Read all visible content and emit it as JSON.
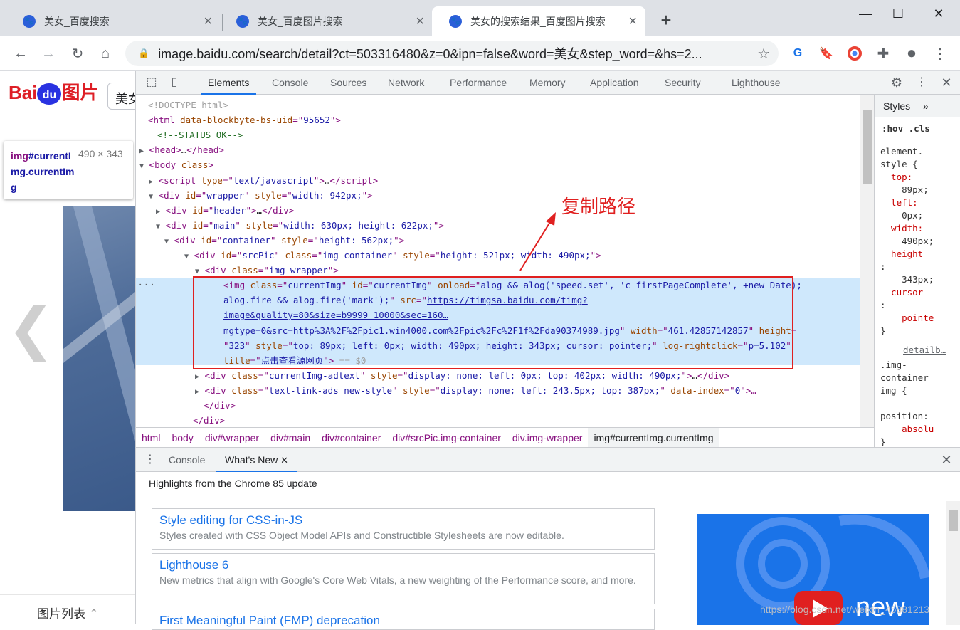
{
  "tabs": [
    {
      "title": "美女_百度搜索",
      "active": false
    },
    {
      "title": "美女_百度图片搜索",
      "active": false
    },
    {
      "title": "美女的搜索结果_百度图片搜索",
      "active": true
    }
  ],
  "new_tab": "+",
  "window": {
    "minimize": "—",
    "maximize": "☐",
    "close": "✕"
  },
  "toolbar": {
    "back": "←",
    "forward": "→",
    "reload": "↻",
    "home": "⌂",
    "url": "image.baidu.com/search/detail?ct=503316480&z=0&ipn=false&word=美女&step_word=&hs=2...",
    "star": "☆",
    "translate": "G",
    "bookmark": "🔖",
    "ext": "✚",
    "profile": "●",
    "menu": "⋮"
  },
  "page": {
    "logo_text": "Bai",
    "logo_du": "du",
    "logo_suffix": "图片",
    "search_value": "美女",
    "tooltip_tag": "img",
    "tooltip_id": "#currentImg.currentImg",
    "tooltip_dim": "490 × 343",
    "list_label": "图片列表",
    "prev_arrow": "❮"
  },
  "devtools": {
    "tabs": [
      "Elements",
      "Console",
      "Sources",
      "Network",
      "Performance",
      "Memory",
      "Application",
      "Security",
      "Lighthouse"
    ],
    "annotation": "复制路径",
    "lines": [
      {
        "indent": 0,
        "html": "<span class='gr'>&lt;!DOCTYPE html&gt;</span>"
      },
      {
        "indent": 0,
        "html": "&lt;html <span class='an'>data-blockbyte-bs-uid</span>=\"<span class='av'>95652</span>\"&gt;"
      },
      {
        "indent": 1,
        "html": "<span class='cm'>&lt;!--STATUS OK--&gt;</span>"
      },
      {
        "indent": 0,
        "arrow": "▶",
        "html": "&lt;head&gt;<span class='tx'>…</span>&lt;/head&gt;"
      },
      {
        "indent": 0,
        "arrow": "▼",
        "html": "&lt;body <span class='an'>class</span>&gt;"
      },
      {
        "indent": 1,
        "arrow": "▶",
        "html": "&lt;script <span class='an'>type</span>=\"<span class='av'>text/javascript</span>\"&gt;<span class='tx'>…</span>&lt;/script&gt;"
      },
      {
        "indent": 1,
        "arrow": "▼",
        "html": "&lt;div <span class='an'>id</span>=\"<span class='av'>wrapper</span>\" <span class='an'>style</span>=\"<span class='av'>width: 942px;</span>\"&gt;"
      },
      {
        "indent": 2,
        "arrow": "▶",
        "html": "&lt;div <span class='an'>id</span>=\"<span class='av'>header</span>\"&gt;<span class='tx'>…</span>&lt;/div&gt;"
      },
      {
        "indent": 2,
        "arrow": "▼",
        "html": "&lt;div <span class='an'>id</span>=\"<span class='av'>main</span>\" <span class='an'>style</span>=\"<span class='av'>width: 630px; height: 622px;</span>\"&gt;"
      },
      {
        "indent": 3,
        "arrow": "▼",
        "html": "&lt;div <span class='an'>id</span>=\"<span class='av'>container</span>\" <span class='an'>style</span>=\"<span class='av'>height: 562px;</span>\"&gt;"
      },
      {
        "indent": 4,
        "arrow": "▼",
        "html": "&lt;div <span class='an'>id</span>=\"<span class='av'>srcPic</span>\" <span class='an'>class</span>=\"<span class='av'>img-container</span>\" <span class='an'>style</span>=\"<span class='av'>height: 521px; width: 490px;</span>\"&gt;"
      },
      {
        "indent": 5,
        "arrow": "▼",
        "html": "&lt;div <span class='an'>class</span>=\"<span class='av'>img-wrapper</span>\"&gt;"
      },
      {
        "indent": 6,
        "html": "&lt;img <span class='an'>class</span>=\"<span class='av'>currentImg</span>\" <span class='an'>id</span>=\"<span class='av'>currentImg</span>\" <span class='an'>onload</span>=\"<span class='av'>alog &amp;&amp; alog('speed.set', 'c_firstPageComplete', +new Date);</span>"
      },
      {
        "indent": 6,
        "html": "<span class='av'>alog.fire &amp;&amp; alog.fire('mark');</span>\" <span class='an'>src</span>=\"<span class='lk'>https://timgsa.baidu.com/timg?</span>"
      },
      {
        "indent": 6,
        "html": "<span class='lk'>image&amp;quality=80&amp;size=b9999_10000&amp;sec=160…</span>"
      },
      {
        "indent": 6,
        "html": "<span class='lk'>mgtype=0&amp;src=http%3A%2F%2Fpic1.win4000.com%2Fpic%2Fc%2F1f%2Fda90374989.jpg</span>\" <span class='an'>width</span>=\"<span class='av'>461.42857142857</span>\" <span class='an'>height</span>="
      },
      {
        "indent": 6,
        "html": "\"<span class='av'>323</span>\" <span class='an'>style</span>=\"<span class='av'>top: 89px; left: 0px; width: 490px; height: 343px; cursor: pointer;</span>\" <span class='an'>log-rightclick</span>=\"<span class='av'>p=5.102</span>\""
      },
      {
        "indent": 6,
        "html": "<span class='an'>title</span>=\"<span class='av'>点击查看源网页</span>\"&gt; <span class='gr'>== $0</span>"
      },
      {
        "indent": 5,
        "arrow": "▶",
        "html": "&lt;div <span class='an'>class</span>=\"<span class='av'>currentImg-adtext</span>\" <span class='an'>style</span>=\"<span class='av'>display: none; left: 0px; top: 402px; width: 490px;</span>\"&gt;<span class='tx'>…</span>&lt;/div&gt;"
      },
      {
        "indent": 5,
        "arrow": "▶",
        "html": "&lt;div <span class='an'>class</span>=\"<span class='av'>text-link-ads new-style</span>\" <span class='an'>style</span>=\"<span class='av'>display: none; left: 243.5px; top: 387px;</span>\" <span class='an'>data-index</span>=\"<span class='av'>0</span>\"&gt;…"
      },
      {
        "indent": 5,
        "html": "&lt;/div&gt;"
      },
      {
        "indent": 4,
        "html": "&lt;/div&gt;"
      }
    ],
    "breadcrumbs": [
      "html",
      "body",
      "div#wrapper",
      "div#main",
      "div#container",
      "div#srcPic.img-container",
      "div.img-wrapper",
      "img#currentImg.currentImg"
    ],
    "styles": {
      "tab": "Styles",
      "more": "»",
      "filter": ":hov  .cls",
      "rules": [
        "element.",
        "style {",
        "  top:",
        "    89px;",
        "  left:",
        "    0px;",
        "  width:",
        "    490px;",
        "  height",
        ":",
        "    343px;",
        "  cursor",
        ":",
        "    pointe",
        "}"
      ],
      "source": "detailb…",
      "rule2": [
        ".img-",
        "container",
        "img {",
        "",
        "position:",
        "    absolu",
        "}"
      ]
    },
    "drawer": {
      "tabs": [
        "Console",
        "What's New"
      ],
      "highlight": "Highlights from the Chrome 85 update",
      "cards": [
        {
          "title": "Style editing for CSS-in-JS",
          "desc": "Styles created with CSS Object Model APIs and Constructible Stylesheets are now editable."
        },
        {
          "title": "Lighthouse 6",
          "desc": "New metrics that align with Google's Core Web Vitals, a new weighting of the Performance score, and more."
        },
        {
          "title": "First Meaningful Paint (FMP) deprecation",
          "desc": ""
        }
      ],
      "img_text": "new"
    },
    "watermark": "https://blog.csdn.net/weixin_45881213"
  }
}
